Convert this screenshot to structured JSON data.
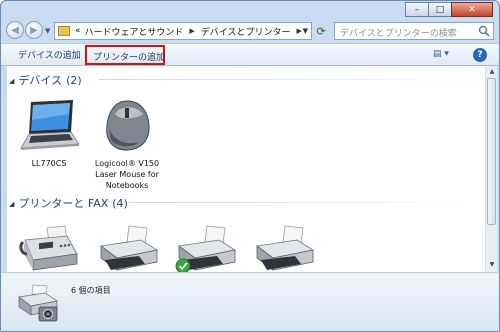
{
  "window": {
    "buttons": {
      "minimize": "–",
      "maximize": "□",
      "close": "✕"
    }
  },
  "nav": {
    "back_icon": "back-arrow-icon",
    "forward_icon": "forward-arrow-icon",
    "breadcrumb_prefix": "«",
    "breadcrumb": [
      "ハードウェアとサウンド",
      "デバイスとプリンター"
    ],
    "search_placeholder": "デバイスとプリンターの検索"
  },
  "toolbar": {
    "add_device": "デバイスの追加",
    "add_printer": "プリンターの追加",
    "highlight_color": "#e01010"
  },
  "groups": [
    {
      "title": "デバイス",
      "count": "(2)",
      "items": [
        {
          "label": "LL770CS",
          "icon": "laptop-icon"
        },
        {
          "label": "Logicool® V150\nLaser Mouse for\nNotebooks",
          "icon": "mouse-icon"
        }
      ]
    },
    {
      "title": "プリンターと FAX",
      "count": "(4)",
      "items": [
        {
          "label": "",
          "icon": "fax-icon"
        },
        {
          "label": "",
          "icon": "printer-icon"
        },
        {
          "label": "",
          "icon": "default-printer-icon"
        },
        {
          "label": "",
          "icon": "printer-icon"
        }
      ]
    }
  ],
  "status": {
    "text": "6 個の項目",
    "icon": "printer-camera-icon"
  },
  "colors": {
    "group_title": "#1e3f8c",
    "window_frame": "#c9dcf1",
    "default_check": "#3aa63a"
  }
}
